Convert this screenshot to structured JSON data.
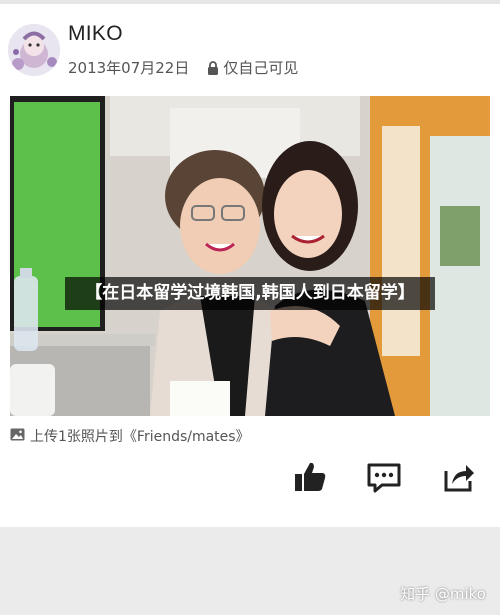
{
  "post": {
    "username": "MIKO",
    "date": "2013年07月22日",
    "privacy_label": "仅自己可见"
  },
  "photo": {
    "caption": "【在日本留学过境韩国,韩国人到日本留学】"
  },
  "upload": {
    "text": "上传1张照片到《Friends/mates》"
  },
  "actions": {
    "icons": [
      "thumbs-up-icon",
      "comment-icon",
      "share-icon"
    ]
  },
  "watermark": {
    "text": "知乎 @miko"
  },
  "colors": {
    "card_bg": "#ffffff",
    "page_bg": "#ebebeb",
    "icon_color": "#222222",
    "caption_bg": "#000000"
  }
}
